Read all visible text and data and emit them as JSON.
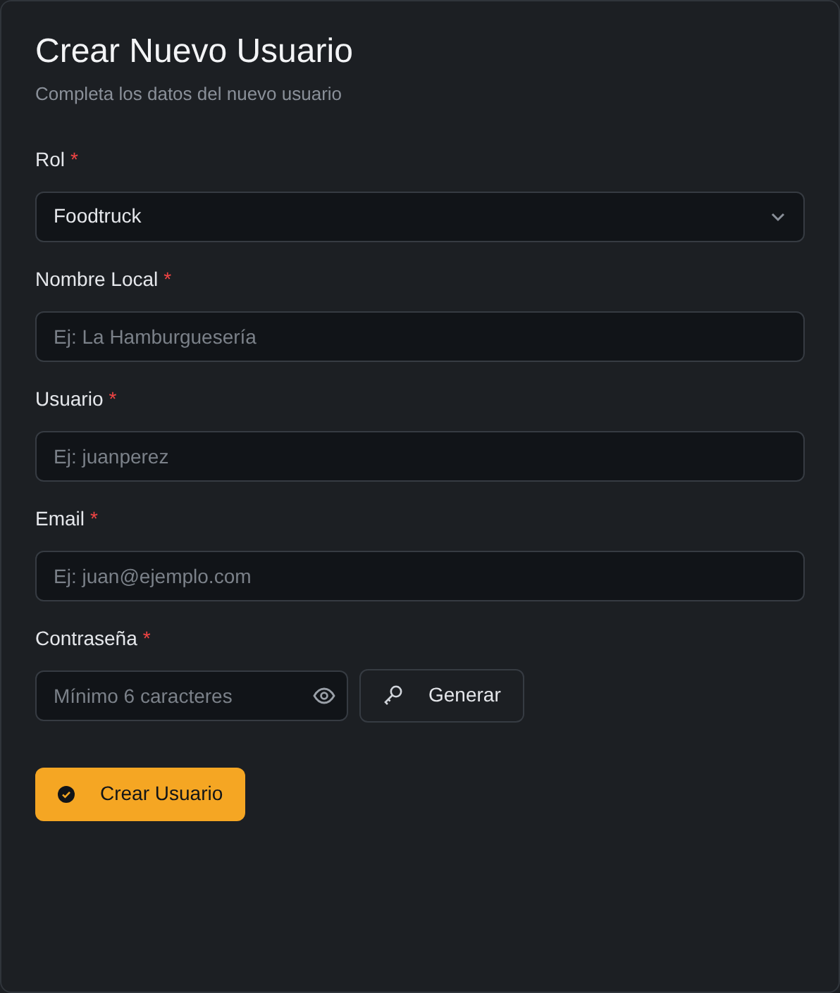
{
  "title": "Crear Nuevo Usuario",
  "subtitle": "Completa los datos del nuevo usuario",
  "fields": [
    {
      "kind": "select",
      "label": "Rol",
      "required_mark": "*",
      "value": "Foodtruck"
    },
    {
      "kind": "text",
      "label": "Nombre Local",
      "required_mark": "*",
      "placeholder": "Ej: La Hamburguesería"
    },
    {
      "kind": "text",
      "label": "Usuario",
      "required_mark": "*",
      "placeholder": "Ej: juanperez"
    },
    {
      "kind": "text",
      "label": "Email",
      "required_mark": "*",
      "placeholder": "Ej: juan@ejemplo.com"
    },
    {
      "kind": "password",
      "label": "Contraseña",
      "required_mark": "*",
      "placeholder": "Mínimo 6 caracteres",
      "generate_label": "Generar"
    }
  ],
  "submit": "Crear Usuario"
}
